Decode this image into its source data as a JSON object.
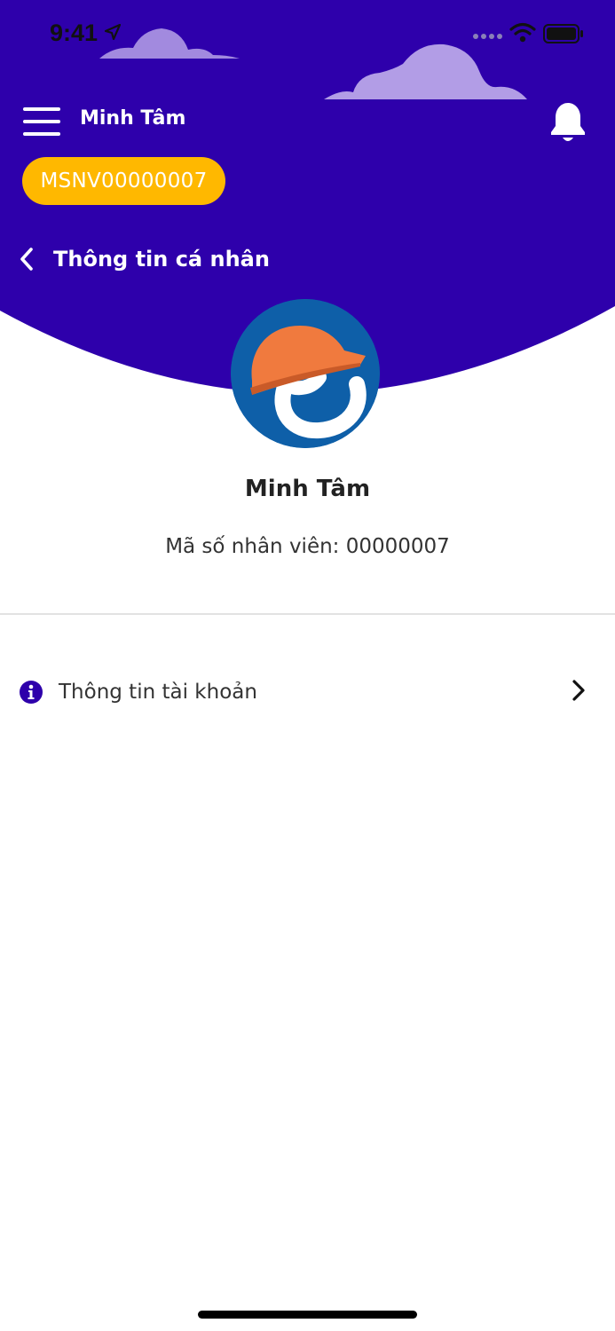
{
  "status_bar": {
    "time": "9:41",
    "icons": [
      "location-arrow-icon",
      "signal-icon",
      "wifi-icon",
      "battery-icon"
    ]
  },
  "header": {
    "user_name": "Minh Tâm",
    "employee_code": "MSNV00000007",
    "icons": [
      "menu-icon",
      "bell-icon"
    ]
  },
  "navigation": {
    "back_icon": "chevron-left-icon",
    "page_title": "Thông tin cá nhân"
  },
  "profile": {
    "avatar": "hardhat-logo-avatar",
    "name": "Minh Tâm",
    "employee_id_label": "Mã số nhân viên: 00000007"
  },
  "menu": {
    "items": [
      {
        "label": "Thông tin tài khoản",
        "icon": "info-circle-icon",
        "trailing_icon": "chevron-right-icon"
      }
    ]
  },
  "colors": {
    "header_background": "#2E00AB",
    "chip_background": "#FFB800",
    "accent": "#2E00AB",
    "avatar_background": "#0E5FA8",
    "hardhat": "#F07A3E"
  }
}
